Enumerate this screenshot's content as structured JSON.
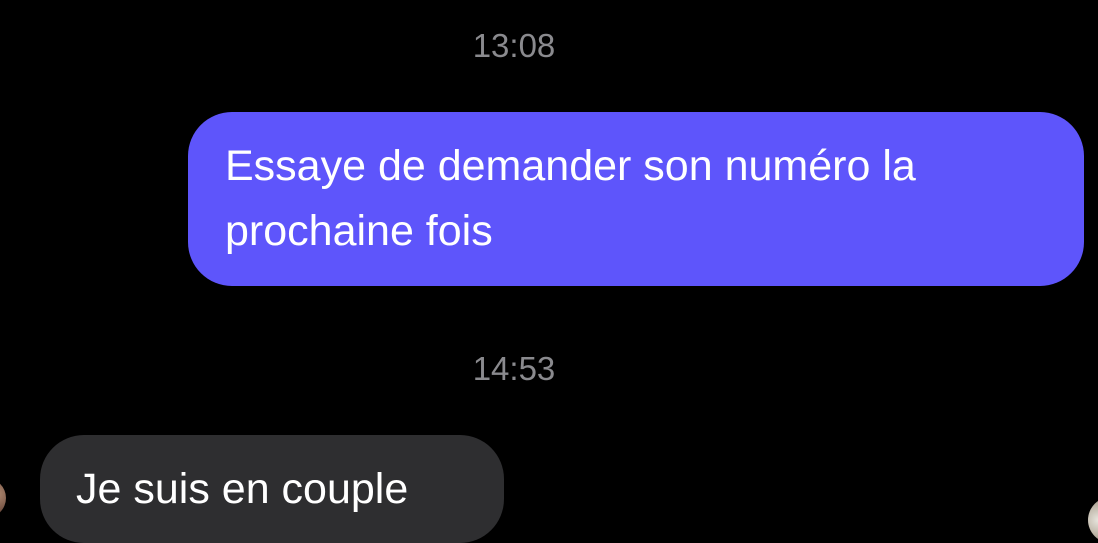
{
  "conversation": {
    "messages": [
      {
        "timestamp": "13:08",
        "direction": "outgoing",
        "text": "Essaye de demander son numéro la prochaine fois"
      },
      {
        "timestamp": "14:53",
        "direction": "incoming",
        "text": "Je suis en couple"
      }
    ]
  },
  "colors": {
    "background": "#000000",
    "outgoing_bubble": "#5e55fb",
    "incoming_bubble": "#2e2e30",
    "timestamp_text": "#8a8a8e",
    "message_text": "#ffffff"
  }
}
